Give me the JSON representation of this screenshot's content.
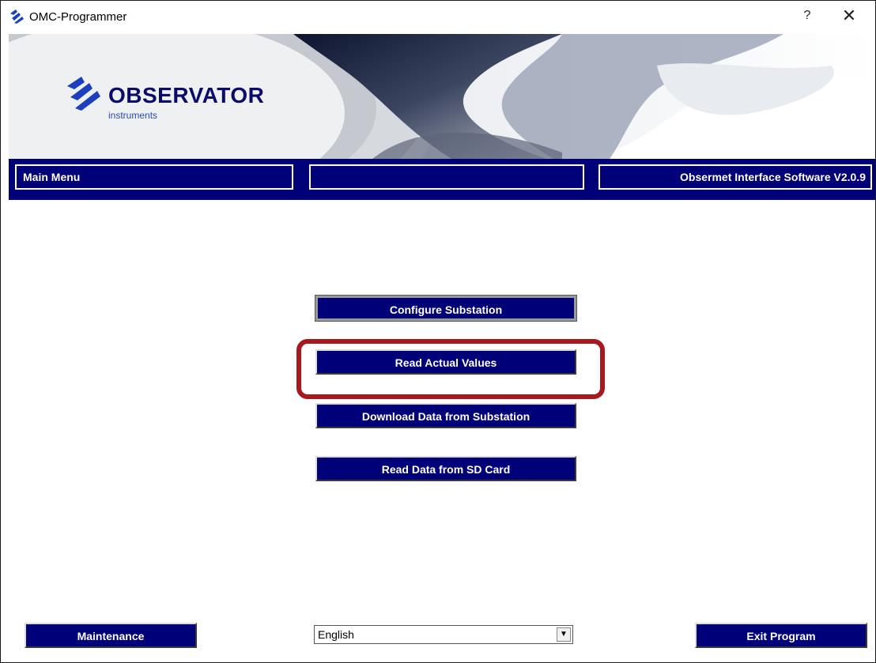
{
  "window": {
    "title": "OMC-Programmer",
    "help_glyph": "?",
    "close_glyph": "✕"
  },
  "banner": {
    "logo_name": "OBSERVATOR",
    "logo_sub": "instruments"
  },
  "menubar": {
    "left_label": "Main Menu",
    "middle_label": "",
    "right_label": "Obsermet Interface Software V2.0.9"
  },
  "main_buttons": {
    "configure": "Configure Substation",
    "read_actual": "Read Actual Values",
    "download": "Download Data from Substation",
    "read_sd": "Read Data from SD Card"
  },
  "footer": {
    "maintenance": "Maintenance",
    "language": {
      "selected": "English",
      "arrow_glyph": "▼"
    },
    "exit": "Exit Program"
  },
  "colors": {
    "accent_navy": "#000078",
    "highlight_red": "#a8181f",
    "logo_blue": "#0b0b6e"
  },
  "icons": {
    "app_icon": "observator-logo-icon",
    "help": "help-icon",
    "close": "close-icon",
    "dropdown": "chevron-down-icon"
  }
}
